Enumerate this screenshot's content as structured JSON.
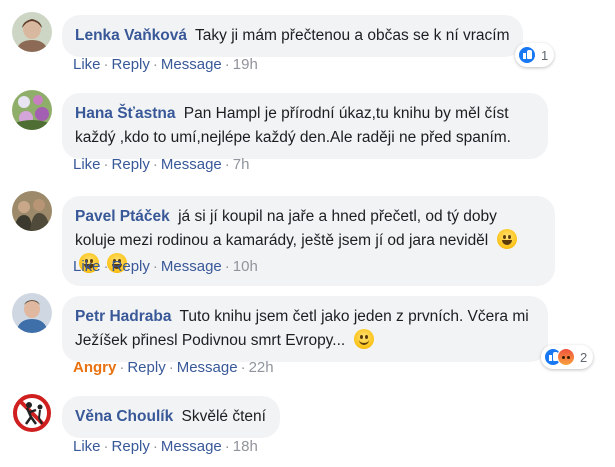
{
  "comments": [
    {
      "author": "Lenka Vaňková",
      "text": "Taky ji mám přečtenou a občas se k ní vracím",
      "actions": {
        "like": "Like",
        "reply": "Reply",
        "message": "Message",
        "time": "19h"
      },
      "reactions": {
        "types": [
          "like"
        ],
        "count": "1"
      },
      "avatar_colors": [
        "#8c6a56",
        "#d9b8a0"
      ]
    },
    {
      "author": "Hana Šťastna",
      "text": "Pan Hampl je přírodní úkaz,tu knihu by měl číst každý ,kdo to umí,nejlépe každý den.Ale raději ne před spaním.",
      "actions": {
        "like": "Like",
        "reply": "Reply",
        "message": "Message",
        "time": "7h"
      },
      "avatar_colors": [
        "#6b8a4a",
        "#c77fc2"
      ]
    },
    {
      "author": "Pavel Ptáček",
      "text": "já si jí koupil na jaře a hned přečetl, od tý doby koluje mezi rodinou a kamarády, ještě jsem jí od jara neviděl",
      "emoji": [
        "grinning-emoji",
        "grinning-emoji",
        "grinning-emoji"
      ],
      "actions": {
        "like": "Like",
        "reply": "Reply",
        "message": "Message",
        "time": "10h"
      },
      "avatar_colors": [
        "#4f4a3a",
        "#9c8a6a"
      ]
    },
    {
      "author": "Petr Hadraba",
      "text": "Tuto knihu jsem četl jako jeden z prvních. Včera mi Ježíšek přinesl Podivnou smrt Evropy...",
      "emoji": [
        "smiling-emoji"
      ],
      "actions": {
        "like": "Angry",
        "reply": "Reply",
        "message": "Message",
        "time": "22h"
      },
      "reactions": {
        "types": [
          "like",
          "angry"
        ],
        "count": "2"
      },
      "avatar_colors": [
        "#3e6fa8",
        "#e0b8a0"
      ]
    },
    {
      "author": "Věna Choulík",
      "text": "Skvělé čtení",
      "actions": {
        "like": "Like",
        "reply": "Reply",
        "message": "Message",
        "time": "18h"
      },
      "avatar_colors": [
        "#d01f1f",
        "#ffffff"
      ]
    }
  ],
  "colors": {
    "author": "#385898",
    "bubble": "#f2f3f5",
    "angry": "#e9710f",
    "meta": "#90949c"
  }
}
